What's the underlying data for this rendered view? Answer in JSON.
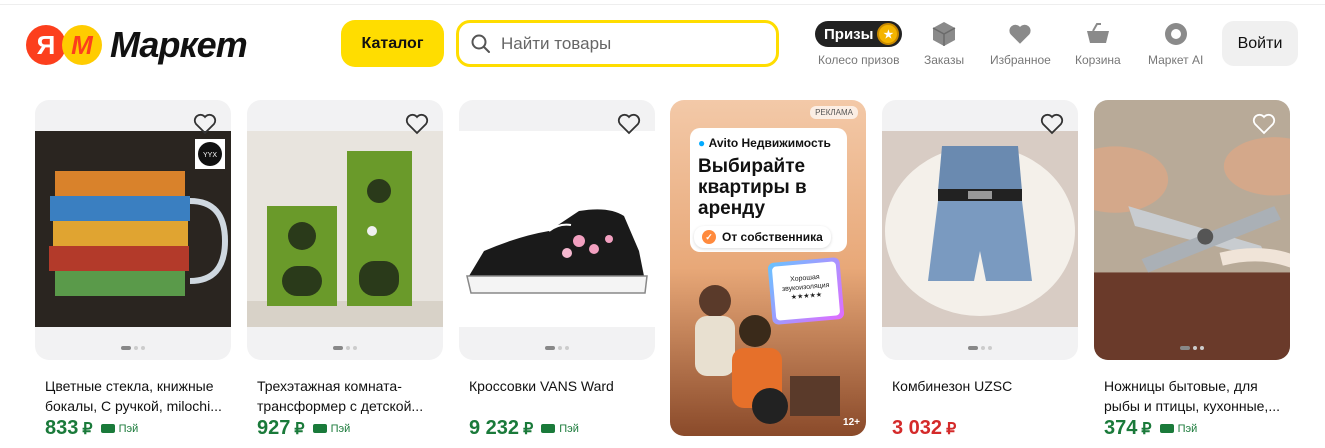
{
  "header": {
    "logo_ya": "Я",
    "logo_m": "М",
    "logo_word": "Маркет",
    "catalog_label": "Каталог",
    "search_placeholder": "Найти товары",
    "prizes_badge": "Призы",
    "nav": {
      "prizes": "Колесо призов",
      "orders": "Заказы",
      "favorites": "Избранное",
      "cart": "Корзина",
      "ai": "Маркет AI"
    },
    "login_label": "Войти"
  },
  "colors": {
    "accent_yellow": "#ffdd00",
    "price_green": "#1a7a3a",
    "price_red": "#d42a2a",
    "brand_red": "#fc3f1d"
  },
  "products": [
    {
      "title": "Цветные стекла, книжные бокалы, С ручкой, milochi...",
      "price": "833",
      "currency": "₽",
      "pay": "Пэй",
      "sale": false,
      "icon": "glass-mug-image"
    },
    {
      "title": "Трехэтажная комната-трансформер с детской...",
      "price": "927",
      "currency": "₽",
      "pay": "Пэй",
      "sale": false,
      "icon": "cat-tower-image"
    },
    {
      "title": "Кроссовки VANS Ward",
      "price": "9 232",
      "currency": "₽",
      "pay": "Пэй",
      "sale": false,
      "icon": "sneaker-image"
    },
    {
      "title": "Комбинезон UZSC",
      "price": "3 032",
      "currency": "₽",
      "pay": "",
      "sale": true,
      "icon": "denim-romper-image"
    },
    {
      "title": "Ножницы бытовые, для рыбы и птицы, кухонные,...",
      "price": "374",
      "currency": "₽",
      "pay": "Пэй",
      "sale": false,
      "icon": "scissors-image"
    }
  ],
  "ad": {
    "tag": "РЕКЛАМА",
    "brand": "Avito Недвижимость",
    "headline": "Выбирайте квартиры в аренду",
    "pill": "От собственника",
    "screen_text": "Хорошая звукоизоляция ★★★★★",
    "age": "12+"
  }
}
